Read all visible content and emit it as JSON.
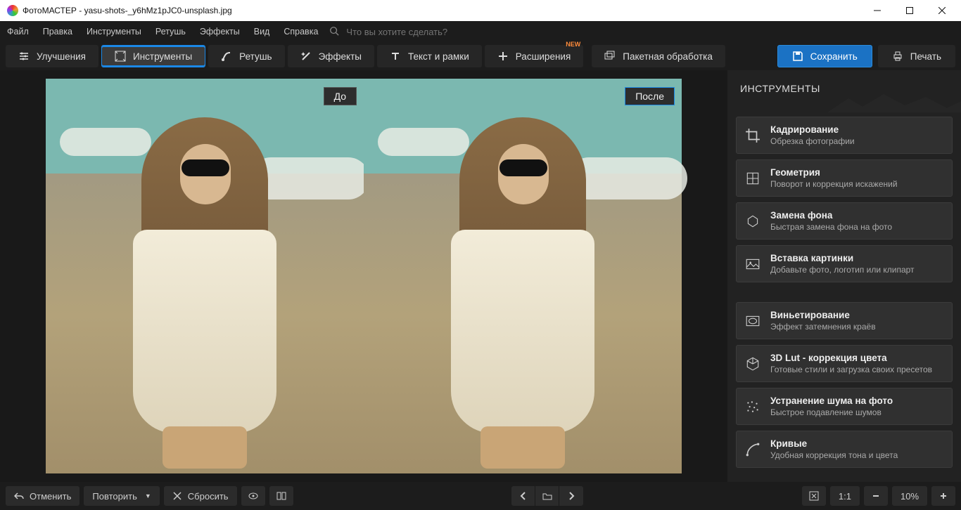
{
  "window": {
    "title": "ФотоМАСТЕР - yasu-shots-_y6hMz1pJC0-unsplash.jpg"
  },
  "menu": {
    "items": [
      "Файл",
      "Правка",
      "Инструменты",
      "Ретушь",
      "Эффекты",
      "Вид",
      "Справка"
    ],
    "search_placeholder": "Что вы хотите сделать?"
  },
  "toolbar": {
    "enhance": "Улучшения",
    "tools": "Инструменты",
    "retouch": "Ретушь",
    "effects": "Эффекты",
    "text": "Текст и рамки",
    "ext": "Расширения",
    "ext_badge": "NEW",
    "batch": "Пакетная обработка",
    "save": "Сохранить",
    "print": "Печать"
  },
  "canvas": {
    "before": "До",
    "after": "После"
  },
  "panel": {
    "title": "ИНСТРУМЕНТЫ",
    "groups": [
      [
        {
          "t": "Кадрирование",
          "s": "Обрезка фотографии"
        },
        {
          "t": "Геометрия",
          "s": "Поворот и коррекция искажений"
        },
        {
          "t": "Замена фона",
          "s": "Быстрая замена фона на фото"
        },
        {
          "t": "Вставка картинки",
          "s": "Добавьте фото, логотип или клипарт"
        }
      ],
      [
        {
          "t": "Виньетирование",
          "s": "Эффект затемнения краёв"
        },
        {
          "t": "3D Lut - коррекция цвета",
          "s": "Готовые стили и загрузка своих пресетов"
        },
        {
          "t": "Устранение шума на фото",
          "s": "Быстрое подавление шумов"
        },
        {
          "t": "Кривые",
          "s": "Удобная коррекция тона и цвета"
        }
      ]
    ]
  },
  "bottom": {
    "undo": "Отменить",
    "redo": "Повторить",
    "reset": "Сбросить",
    "fit": "1:1",
    "zoom": "10%"
  }
}
